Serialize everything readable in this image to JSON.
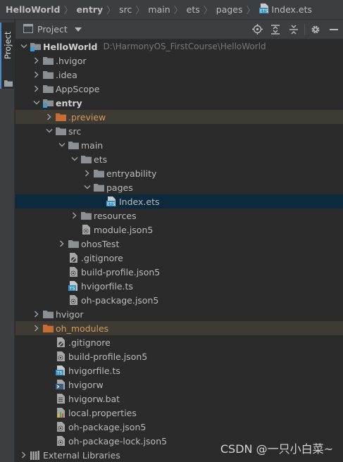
{
  "breadcrumb": [
    {
      "label": "HelloWorld",
      "bold": true,
      "icon": "none"
    },
    {
      "label": "entry",
      "bold": true,
      "icon": "none"
    },
    {
      "label": "src",
      "bold": false,
      "icon": "none"
    },
    {
      "label": "main",
      "bold": false,
      "icon": "none"
    },
    {
      "label": "ets",
      "bold": false,
      "icon": "none"
    },
    {
      "label": "pages",
      "bold": false,
      "icon": "none"
    },
    {
      "label": "Index.ets",
      "bold": false,
      "icon": "ets-file-icon"
    }
  ],
  "stripe": {
    "tab_label": "Project"
  },
  "toolbar": {
    "title": "Project"
  },
  "tree": [
    {
      "label": "HelloWorld",
      "depth": 0,
      "arrow": "down",
      "icon": "module-folder",
      "bold": true,
      "path": "D:\\HarmonyOS_FirstCourse\\HelloWorld"
    },
    {
      "label": ".hvigor",
      "depth": 1,
      "arrow": "right",
      "icon": "folder"
    },
    {
      "label": ".idea",
      "depth": 1,
      "arrow": "right",
      "icon": "folder"
    },
    {
      "label": "AppScope",
      "depth": 1,
      "arrow": "right",
      "icon": "folder"
    },
    {
      "label": "entry",
      "depth": 1,
      "arrow": "down",
      "icon": "module-folder",
      "bold": true
    },
    {
      "label": ".preview",
      "depth": 2,
      "arrow": "right",
      "icon": "folder-orange",
      "highlight": true
    },
    {
      "label": "src",
      "depth": 2,
      "arrow": "down",
      "icon": "folder"
    },
    {
      "label": "main",
      "depth": 3,
      "arrow": "down",
      "icon": "folder"
    },
    {
      "label": "ets",
      "depth": 4,
      "arrow": "down",
      "icon": "folder"
    },
    {
      "label": "entryability",
      "depth": 5,
      "arrow": "right",
      "icon": "folder"
    },
    {
      "label": "pages",
      "depth": 5,
      "arrow": "down",
      "icon": "folder"
    },
    {
      "label": "Index.ets",
      "depth": 6,
      "arrow": "none",
      "icon": "ets-file",
      "selected": true
    },
    {
      "label": "resources",
      "depth": 4,
      "arrow": "right",
      "icon": "folder"
    },
    {
      "label": "module.json5",
      "depth": 4,
      "arrow": "none",
      "icon": "json-file"
    },
    {
      "label": "ohosTest",
      "depth": 3,
      "arrow": "right",
      "icon": "folder"
    },
    {
      "label": ".gitignore",
      "depth": 3,
      "arrow": "none",
      "icon": "gitignore-file"
    },
    {
      "label": "build-profile.json5",
      "depth": 3,
      "arrow": "none",
      "icon": "json-file"
    },
    {
      "label": "hvigorfile.ts",
      "depth": 3,
      "arrow": "none",
      "icon": "ts-file"
    },
    {
      "label": "oh-package.json5",
      "depth": 3,
      "arrow": "none",
      "icon": "json-file"
    },
    {
      "label": "hvigor",
      "depth": 1,
      "arrow": "right",
      "icon": "folder"
    },
    {
      "label": "oh_modules",
      "depth": 1,
      "arrow": "right",
      "icon": "folder-orange",
      "highlight": true
    },
    {
      "label": ".gitignore",
      "depth": 2,
      "arrow": "none",
      "icon": "gitignore-file"
    },
    {
      "label": "build-profile.json5",
      "depth": 2,
      "arrow": "none",
      "icon": "json-file"
    },
    {
      "label": "hvigorfile.ts",
      "depth": 2,
      "arrow": "none",
      "icon": "ts-file"
    },
    {
      "label": "hvigorw",
      "depth": 2,
      "arrow": "none",
      "icon": "shell-file"
    },
    {
      "label": "hvigorw.bat",
      "depth": 2,
      "arrow": "none",
      "icon": "text-file"
    },
    {
      "label": "local.properties",
      "depth": 2,
      "arrow": "none",
      "icon": "properties-file"
    },
    {
      "label": "oh-package.json5",
      "depth": 2,
      "arrow": "none",
      "icon": "json-file"
    },
    {
      "label": "oh-package-lock.json5",
      "depth": 2,
      "arrow": "none",
      "icon": "json-file"
    },
    {
      "label": "External Libraries",
      "depth": 0,
      "arrow": "right",
      "icon": "libraries"
    }
  ],
  "colors": {
    "selection": "#0d293e",
    "excluded_highlight": "#3d3b33",
    "excluded_text": "#d5995a",
    "folder": "#8a8f94",
    "accent": "#4a88c7"
  },
  "watermark": "CSDN @一只小白菜~"
}
